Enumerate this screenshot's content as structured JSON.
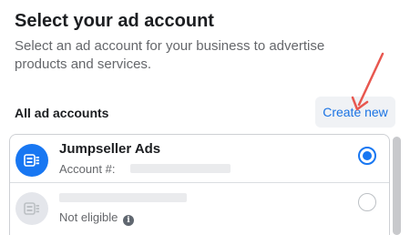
{
  "header": {
    "title": "Select your ad account",
    "subtitle": "Select an ad account for your business to advertise products and services."
  },
  "section": {
    "label": "All ad accounts",
    "create_label": "Create new"
  },
  "accounts": [
    {
      "name": "Jumpseller Ads",
      "sub_label": "Account #:",
      "selected": true,
      "icon": "ad-account-icon"
    },
    {
      "name": "",
      "sub_label": "Not eligible",
      "selected": false,
      "icon": "ad-account-icon"
    }
  ],
  "colors": {
    "accent": "#1877f2",
    "link": "#1b74e4",
    "annotation_arrow": "#e8574f"
  }
}
